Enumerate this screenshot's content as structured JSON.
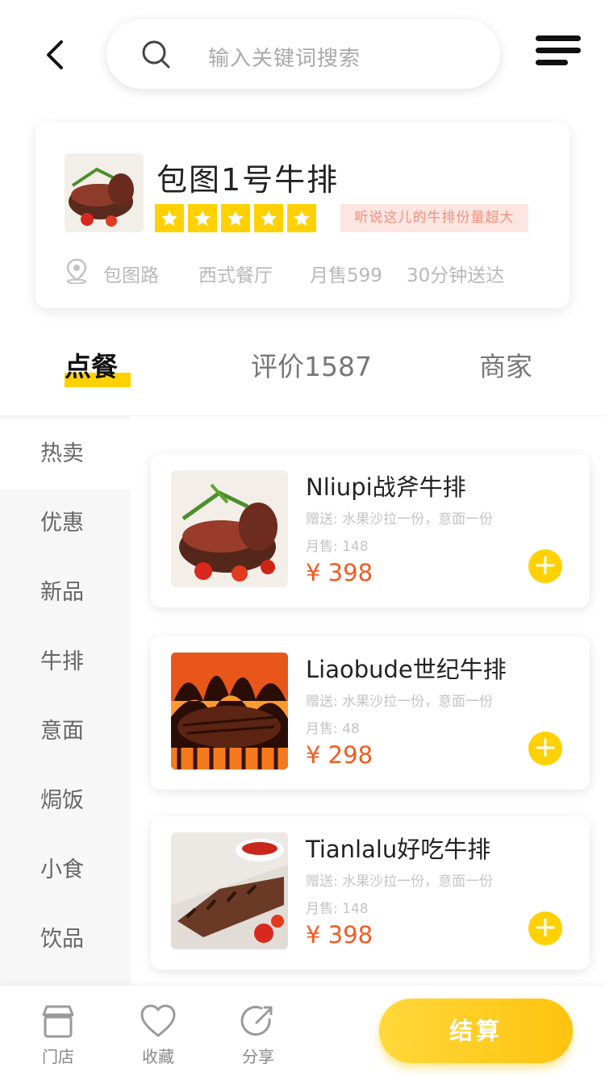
{
  "search": {
    "placeholder": "输入关键词搜索"
  },
  "shop": {
    "name": "包图1号牛排",
    "rating_stars": 5,
    "tag": "听说这儿的牛排份量超大",
    "location": "包图路",
    "category": "西式餐厅",
    "monthly_sales": "月售599",
    "delivery": "30分钟送达"
  },
  "tabs": [
    {
      "label": "点餐",
      "active": true
    },
    {
      "label": "评价1587",
      "active": false
    },
    {
      "label": "商家",
      "active": false
    }
  ],
  "sidebar": {
    "items": [
      {
        "label": "热卖",
        "active": true
      },
      {
        "label": "优惠"
      },
      {
        "label": "新品"
      },
      {
        "label": "牛排"
      },
      {
        "label": "意面"
      },
      {
        "label": "焗饭"
      },
      {
        "label": "小食"
      },
      {
        "label": "饮品"
      }
    ]
  },
  "products": [
    {
      "name": "Nliupi战斧牛排",
      "gift": "赠送: 水果沙拉一份，意面一份",
      "sold": "月售: 148",
      "price": "¥ 398"
    },
    {
      "name": "Liaobude世纪牛排",
      "gift": "赠送: 水果沙拉一份，意面一份",
      "sold": "月售: 48",
      "price": "¥ 298"
    },
    {
      "name": "Tianlalu好吃牛排",
      "gift": "赠送: 水果沙拉一份，意面一份",
      "sold": "月售: 148",
      "price": "¥ 398"
    }
  ],
  "bottom_bar": {
    "items": [
      {
        "label": "门店",
        "icon": "store-icon"
      },
      {
        "label": "收藏",
        "icon": "heart-icon"
      },
      {
        "label": "分享",
        "icon": "share-icon"
      }
    ],
    "checkout_label": "结算"
  },
  "colors": {
    "accent": "#ffd100",
    "price": "#f25b22",
    "tag_bg": "#fde6e1",
    "tag_text": "#f2907f"
  }
}
